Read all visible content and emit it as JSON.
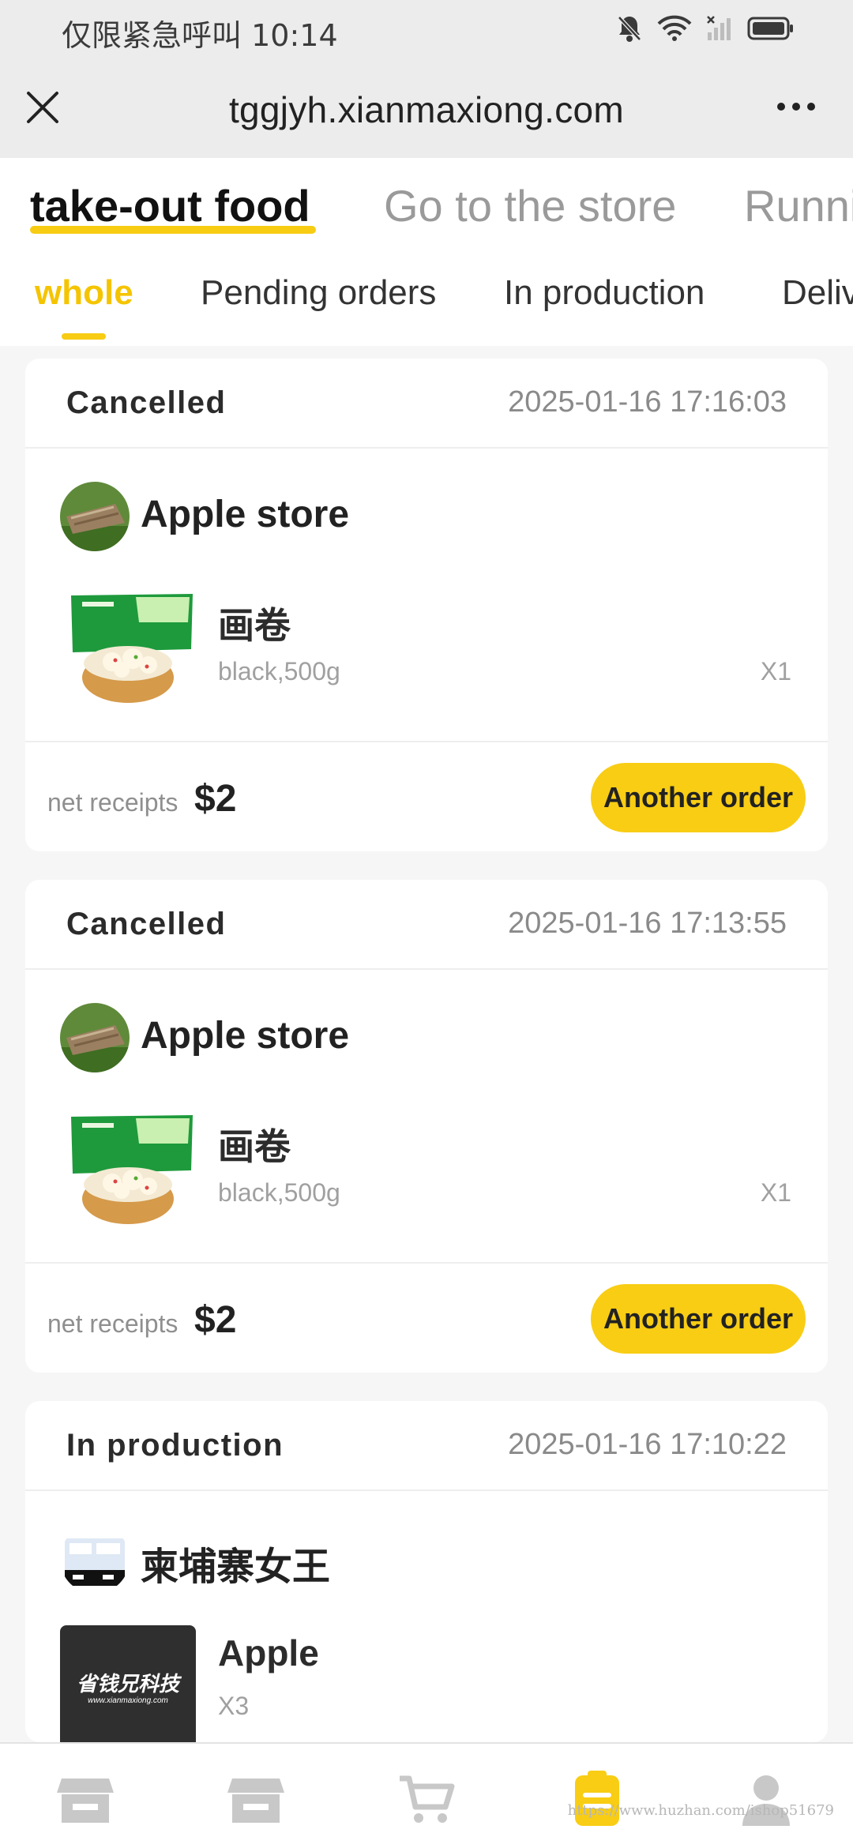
{
  "status_bar": {
    "carrier_text": "仅限紧急呼叫",
    "time": "10:14",
    "icons": [
      "bell-muted-icon",
      "wifi-icon",
      "signal-icon",
      "battery-icon"
    ]
  },
  "browser": {
    "url": "tggjyh.xianmaxiong.com",
    "close_icon": "close-icon",
    "more_icon": "more-icon"
  },
  "main_tabs": [
    {
      "label": "take-out food",
      "active": true
    },
    {
      "label": "Go to the store",
      "active": false
    },
    {
      "label": "Running errands",
      "active": false
    }
  ],
  "sub_tabs": [
    {
      "label": "whole",
      "active": true
    },
    {
      "label": "Pending orders",
      "active": false
    },
    {
      "label": "In production",
      "active": false
    },
    {
      "label": "Delivering",
      "active": false
    }
  ],
  "orders": [
    {
      "status": "Cancelled",
      "time": "2025-01-16 17:16:03",
      "store": "Apple store",
      "item_name": "画卷",
      "item_spec": "black,500g",
      "item_qty": "X1",
      "net_label": "net receipts",
      "net_value": "$2",
      "action": "Another order"
    },
    {
      "status": "Cancelled",
      "time": "2025-01-16 17:13:55",
      "store": "Apple store",
      "item_name": "画卷",
      "item_spec": "black,500g",
      "item_qty": "X1",
      "net_label": "net receipts",
      "net_value": "$2",
      "action": "Another order"
    },
    {
      "status": "In production",
      "time": "2025-01-16 17:10:22",
      "store": "柬埔寨女王",
      "item_name": "Apple",
      "item_spec": "X3",
      "item_thumb_text": "省钱兄科技",
      "item_thumb_subtext": "www.xianmaxiong.com"
    }
  ],
  "bottom_nav": [
    "store-icon",
    "shop-icon",
    "cart-icon",
    "orders-icon",
    "profile-icon"
  ],
  "watermark": "https://www.huzhan.com/ishop51679",
  "colors": {
    "accent": "#f8cd14",
    "active_tab_text": "#f5c400",
    "muted": "#9a9a9a"
  }
}
